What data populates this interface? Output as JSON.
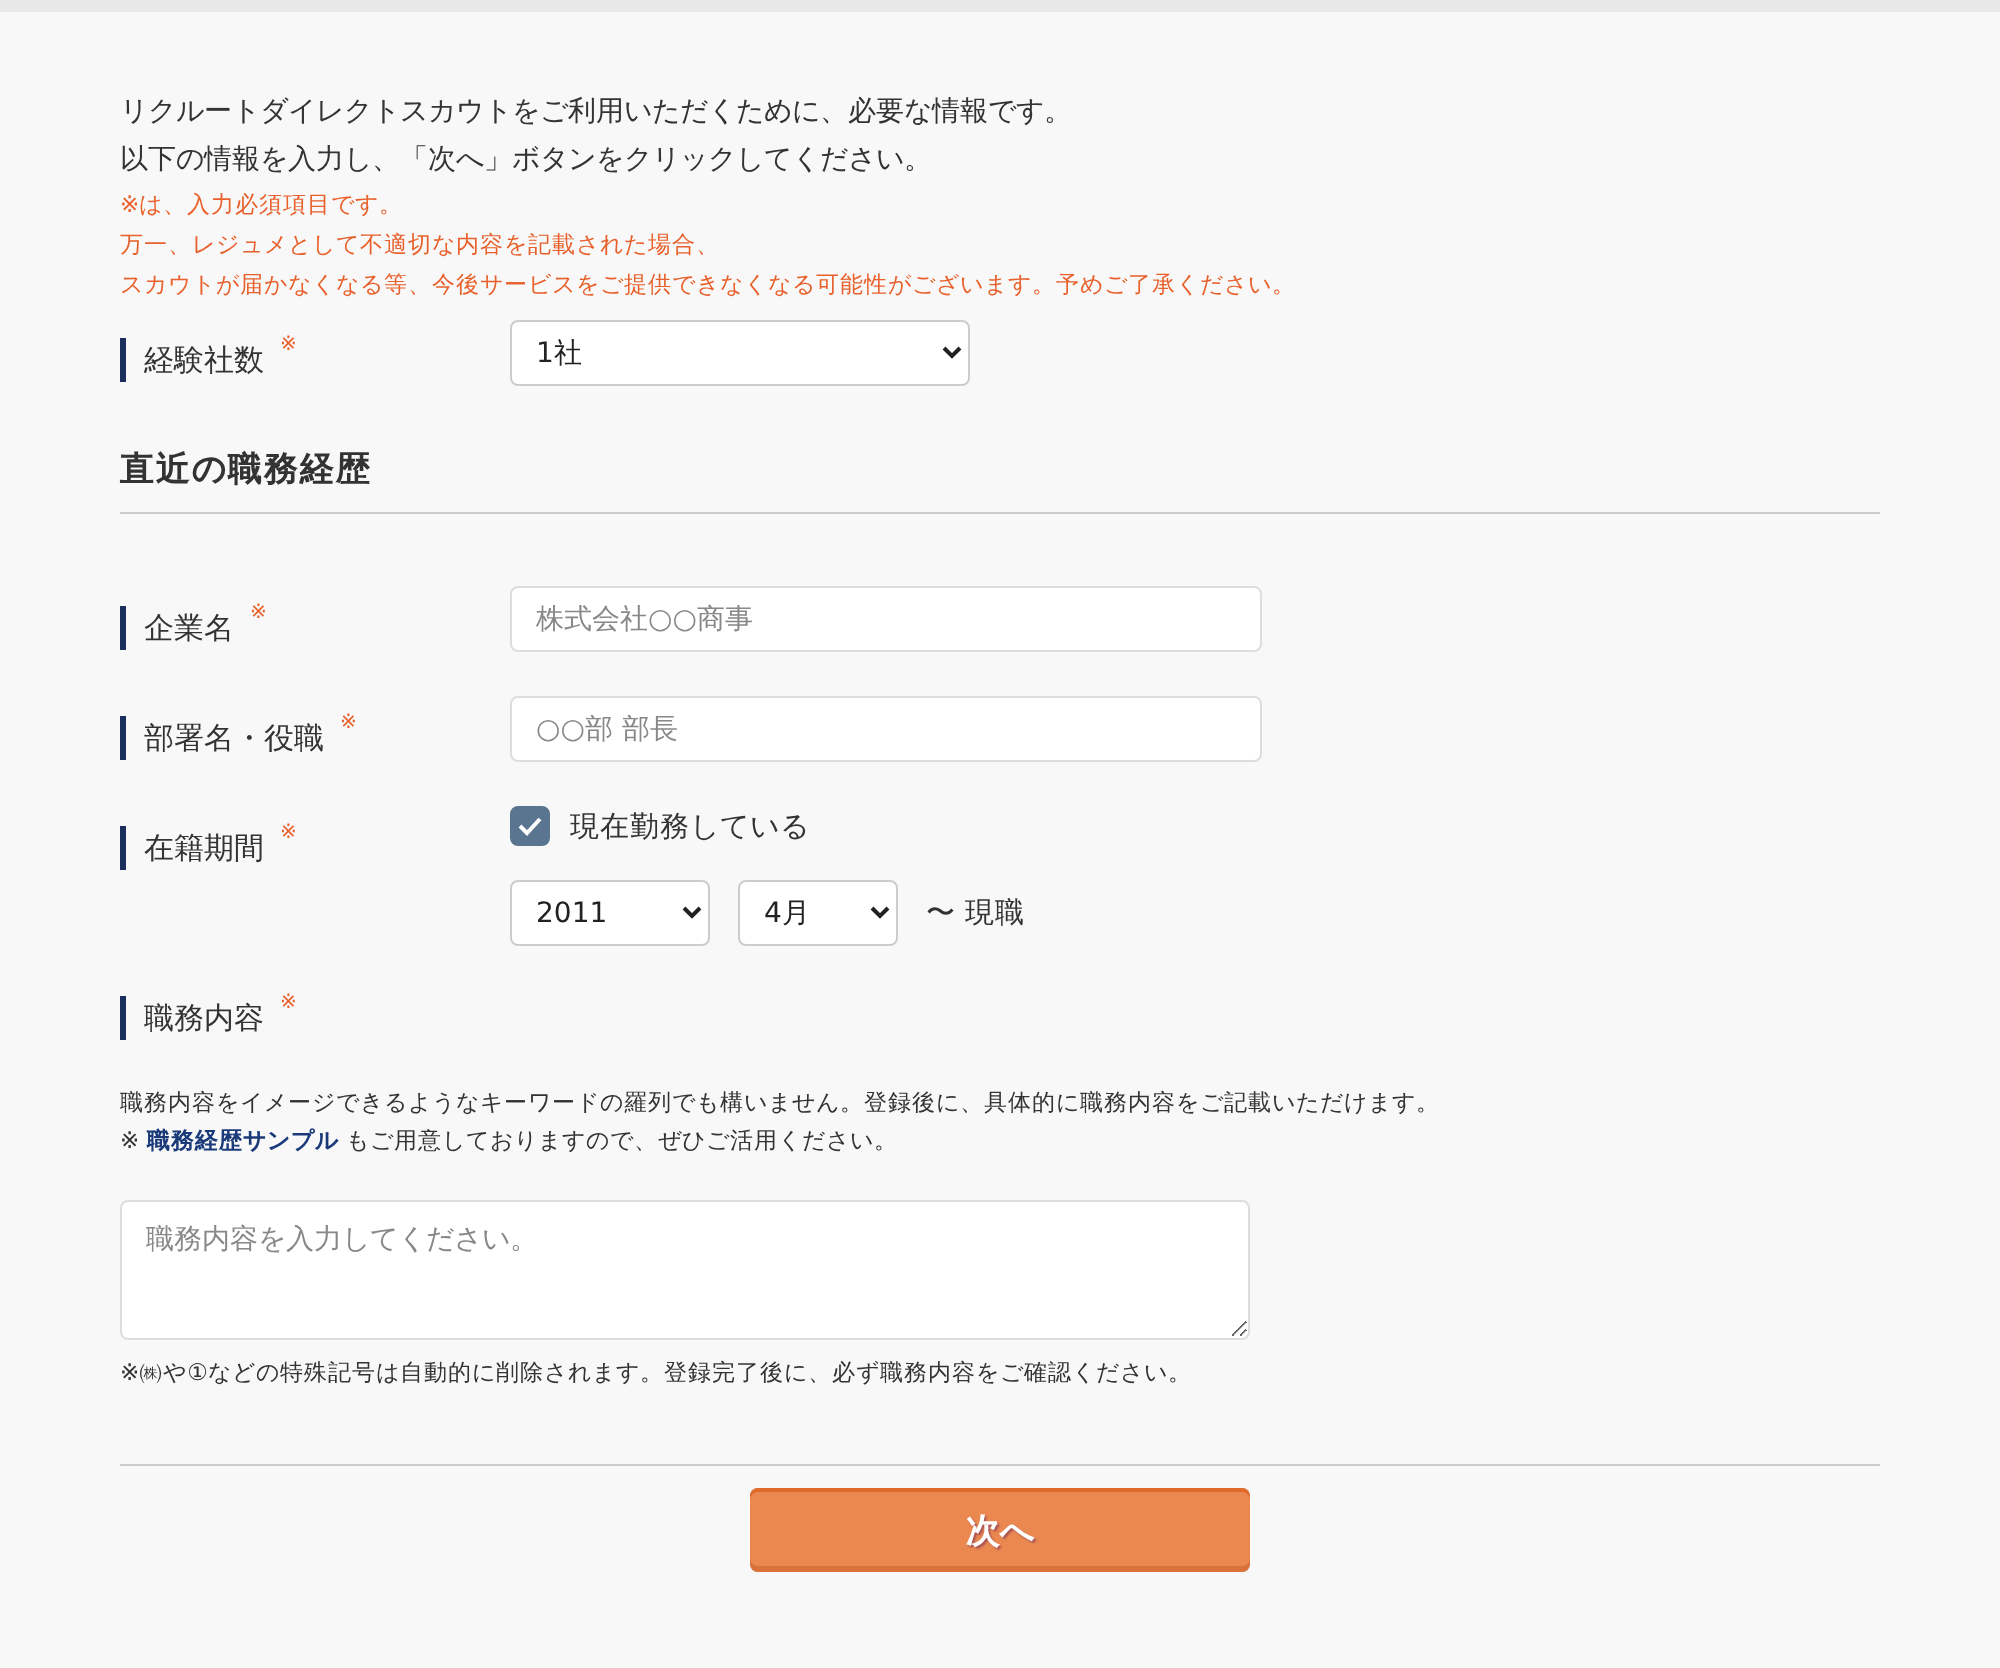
{
  "intro": {
    "lines": [
      "リクルートダイレクトスカウトをご利用いただくために、必要な情報です。",
      "以下の情報を入力し、「次へ」ボタンをクリックしてください。"
    ],
    "notices": [
      "※は、入力必須項目です。",
      "万一、レジュメとして不適切な内容を記載された場合、",
      "スカウトが届かなくなる等、今後サービスをご提供できなくなる可能性がございます。予めご了承ください。"
    ]
  },
  "company_count": {
    "label": "経験社数",
    "required_mark": "※",
    "value": "1社"
  },
  "section_title": "直近の職務経歴",
  "fields": [
    {
      "kind": "text",
      "label": "企業名",
      "required_mark": "※",
      "placeholder": "株式会社○○商事"
    },
    {
      "kind": "text",
      "label": "部署名・役職",
      "required_mark": "※",
      "placeholder": "○○部 部長"
    },
    {
      "kind": "period",
      "label": "在籍期間",
      "required_mark": "※",
      "checkbox_label": "現在勤務している",
      "checked": true,
      "year": "2011",
      "month": "4月",
      "until": "〜 現職"
    }
  ],
  "duties": {
    "label": "職務内容",
    "required_mark": "※",
    "description": "職務内容をイメージできるようなキーワードの羅列でも構いません。登録後に、具体的に職務内容をご記載いただけます。",
    "sample_prefix": "※",
    "sample_link": "職務経歴サンプル",
    "sample_suffix": "もご用意しておりますので、ぜひご活用ください。",
    "placeholder": "職務内容を入力してください。",
    "note": "※㈱や①などの特殊記号は自動的に削除されます。登録完了後に、必ず職務内容をご確認ください。"
  },
  "next_button": "次へ"
}
